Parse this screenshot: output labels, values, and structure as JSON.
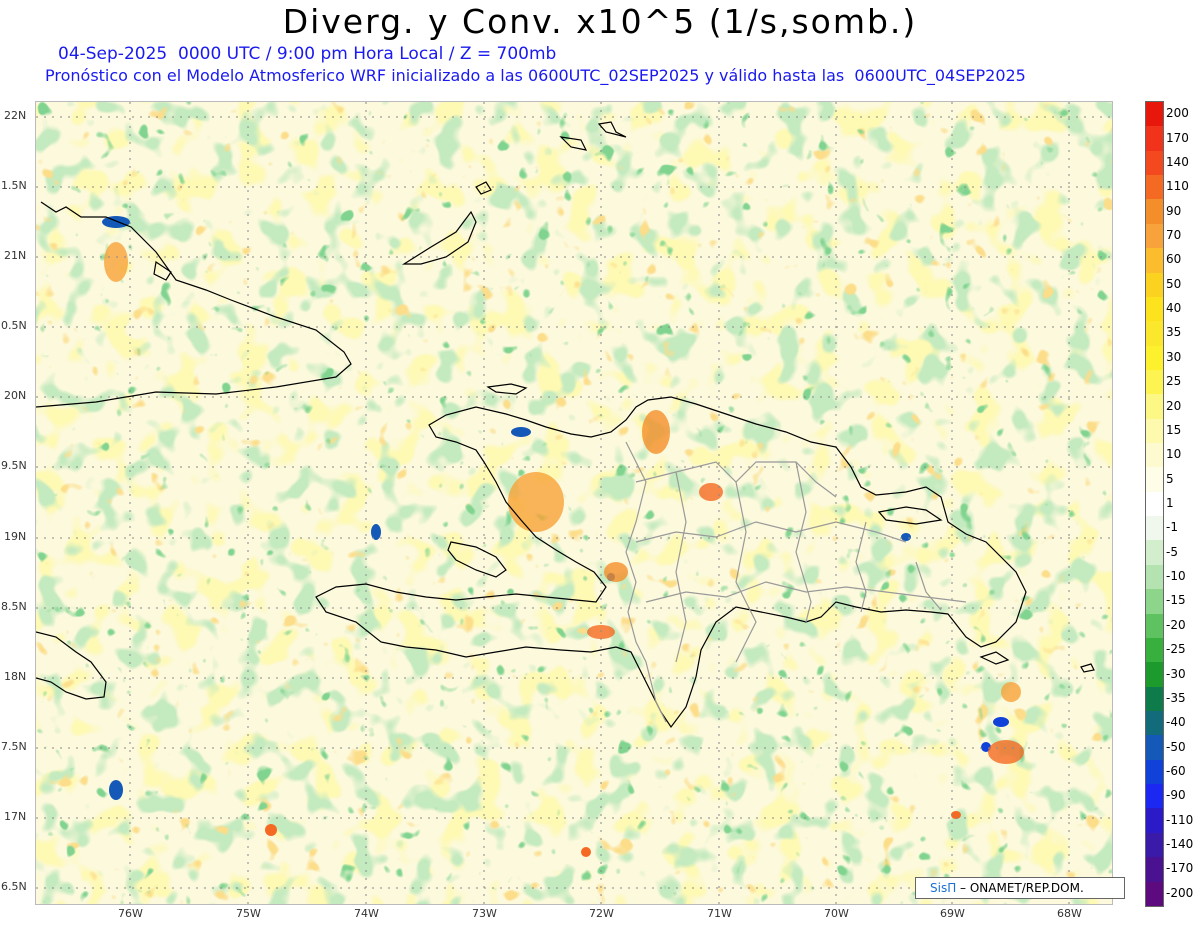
{
  "header": {
    "title": "Diverg. y Conv. x10^5 (1/s,somb.)",
    "subtitle1": "04-Sep-2025  0000 UTC / 9:00 pm Hora Local / Z = 700mb",
    "subtitle2": "Pronóstico con el Modelo Atmosferico WRF inicializado a las 0600UTC_02SEP2025 y válido hasta las  0600UTC_04SEP2025"
  },
  "map": {
    "lat_labels": [
      "22N",
      "1.5N",
      "21N",
      "0.5N",
      "20N",
      "9.5N",
      "19N",
      "8.5N",
      "18N",
      "7.5N",
      "17N",
      "6.5N"
    ],
    "lon_labels": [
      "76W",
      "75W",
      "74W",
      "73W",
      "72W",
      "71W",
      "70W",
      "69W",
      "68W"
    ]
  },
  "colorbar": {
    "labels": [
      "200",
      "170",
      "140",
      "110",
      "90",
      "70",
      "60",
      "50",
      "40",
      "35",
      "30",
      "25",
      "20",
      "15",
      "10",
      "5",
      "1",
      "-1",
      "-5",
      "-10",
      "-15",
      "-20",
      "-25",
      "-30",
      "-35",
      "-40",
      "-50",
      "-60",
      "-90",
      "-110",
      "-140",
      "-170",
      "-200"
    ],
    "colors": [
      "#e8170c",
      "#f2331c",
      "#f4491f",
      "#f46a22",
      "#f48e2a",
      "#f7a23a",
      "#fbbd2d",
      "#fbd21f",
      "#fde21e",
      "#fbe82c",
      "#fdf02d",
      "#fdf452",
      "#fdf886",
      "#fdfaae",
      "#fefad0",
      "#fefde8",
      "#ffffff",
      "#f0f8ee",
      "#d2eecd",
      "#b4e2b0",
      "#8cd58a",
      "#5fc260",
      "#38b03d",
      "#1c9b2c",
      "#0d7c4a",
      "#126b7a",
      "#1458b8",
      "#1042da",
      "#1a28f2",
      "#2a1ac8",
      "#3a1aa8",
      "#4a1290",
      "#5c0a7e"
    ]
  },
  "credit": {
    "brand": "SisΠ",
    "text": " – ONAMET/REP.DOM."
  }
}
